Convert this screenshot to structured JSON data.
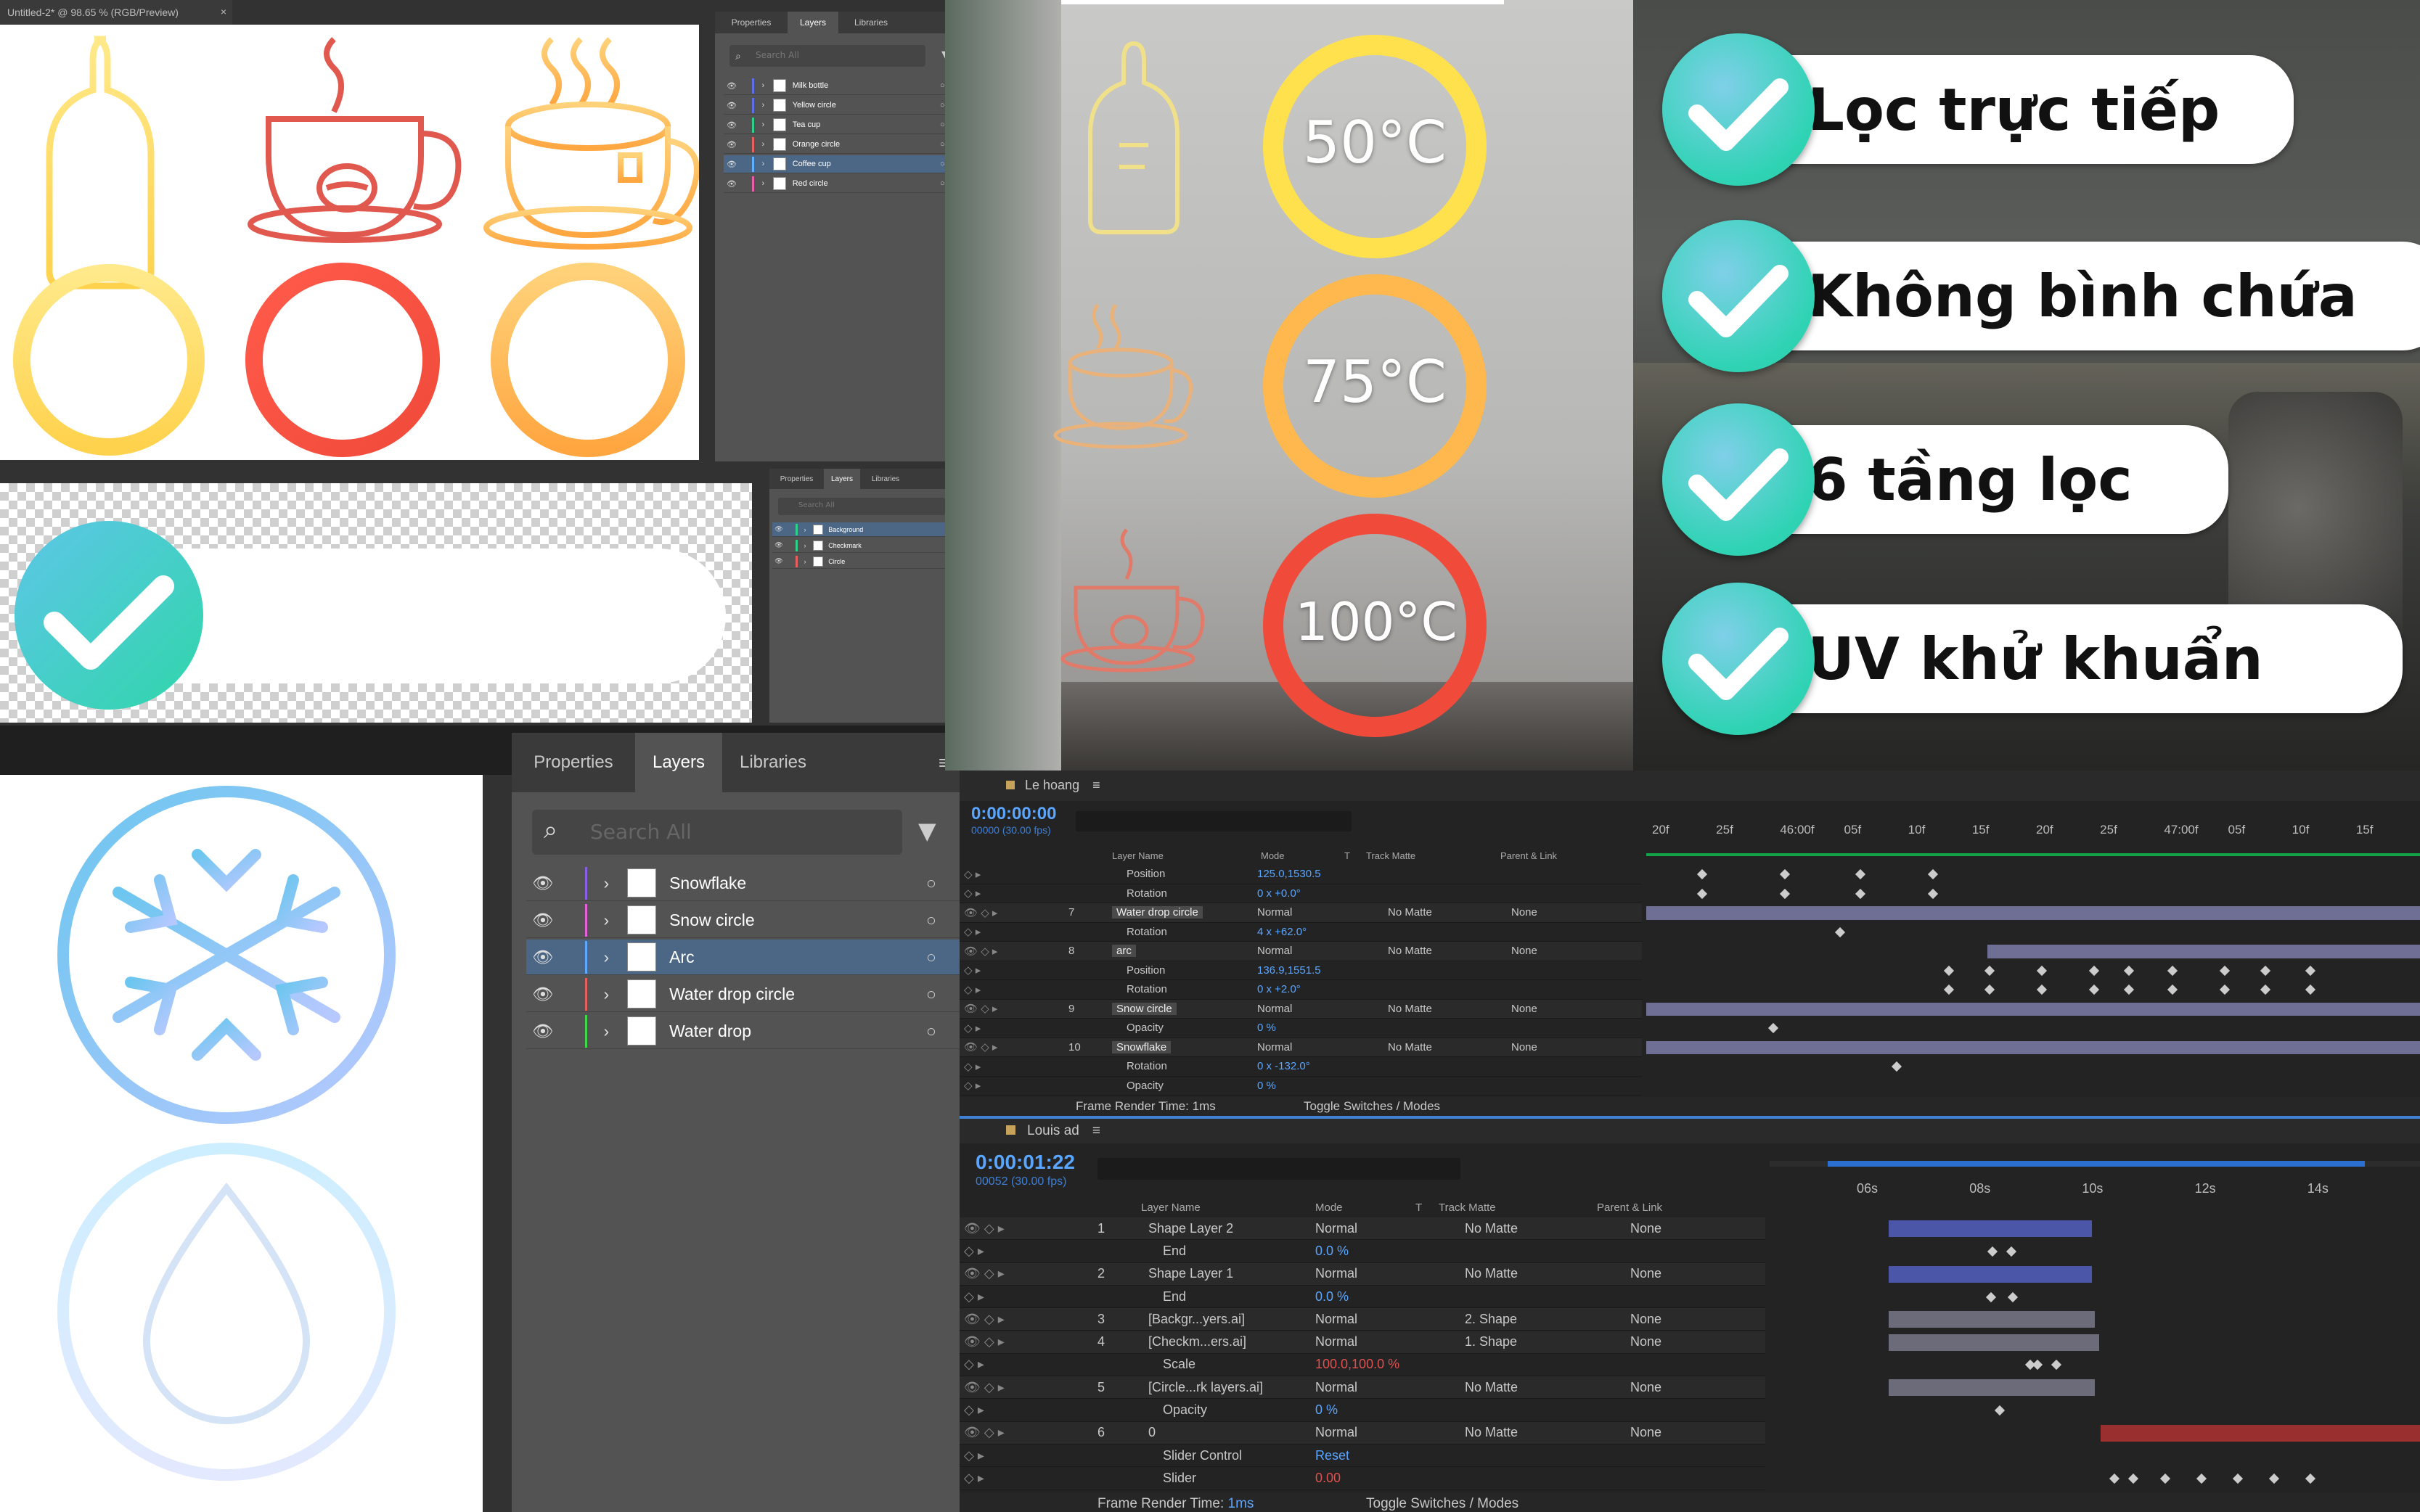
{
  "ai_doc_tab": "Untitled-2* @ 98.65 % (RGB/Preview)",
  "panel_tabs": {
    "properties": "Properties",
    "layers": "Layers",
    "libraries": "Libraries"
  },
  "search_placeholder": "Search All",
  "layers_panel1": [
    "Milk bottle",
    "Yellow circle",
    "Tea cup",
    "Orange circle",
    "Coffee cup",
    "Red circle"
  ],
  "layers_panel2": [
    "Background",
    "Checkmark",
    "Circle"
  ],
  "layers_panel3": [
    "Snowflake",
    "Snow circle",
    "Arc",
    "Water drop circle",
    "Water drop"
  ],
  "video": {
    "temps": [
      "50°C",
      "75°C",
      "100°C"
    ],
    "features": [
      "Lọc trực tiếp",
      "Không bình chứa",
      "6 tầng lọc",
      "UV khử khuẩn"
    ]
  },
  "ae1": {
    "comp": "Le hoang",
    "timecode": "0:00:00:00",
    "fps": "00000 (30.00 fps)",
    "col_layer": "Layer Name",
    "col_mode": "Mode",
    "col_t": "T",
    "col_track": "Track Matte",
    "col_parent": "Parent & Link",
    "ruler": [
      "20f",
      "25f",
      "46:00f",
      "05f",
      "10f",
      "15f",
      "20f",
      "25f",
      "47:00f",
      "05f",
      "10f",
      "15f"
    ],
    "rows": [
      {
        "num": "",
        "name": "Position",
        "value": "125.0,1530.5",
        "type": "prop"
      },
      {
        "num": "",
        "name": "Rotation",
        "value": "0 x +0.0°",
        "type": "prop"
      },
      {
        "num": "7",
        "name": "Water drop circle",
        "mode": "Normal",
        "matte": "No Matte",
        "parent": "None",
        "type": "layer"
      },
      {
        "num": "",
        "name": "Rotation",
        "value": "4 x +62.0°",
        "type": "prop"
      },
      {
        "num": "8",
        "name": "arc",
        "mode": "Normal",
        "matte": "No Matte",
        "parent": "None",
        "type": "layer"
      },
      {
        "num": "",
        "name": "Position",
        "value": "136.9,1551.5",
        "type": "prop"
      },
      {
        "num": "",
        "name": "Rotation",
        "value": "0 x +2.0°",
        "type": "prop"
      },
      {
        "num": "9",
        "name": "Snow circle",
        "mode": "Normal",
        "matte": "No Matte",
        "parent": "None",
        "type": "layer"
      },
      {
        "num": "",
        "name": "Opacity",
        "value": "0 %",
        "type": "prop"
      },
      {
        "num": "10",
        "name": "Snowflake",
        "mode": "Normal",
        "matte": "No Matte",
        "parent": "None",
        "type": "layer"
      },
      {
        "num": "",
        "name": "Rotation",
        "value": "0 x -132.0°",
        "type": "prop"
      },
      {
        "num": "",
        "name": "Opacity",
        "value": "0 %",
        "type": "prop"
      }
    ],
    "footer_render": "Frame Render Time:",
    "footer_time": "1ms",
    "footer_toggle": "Toggle Switches / Modes"
  },
  "ae2": {
    "comp": "Louis ad",
    "timecode": "0:00:01:22",
    "fps": "00052 (30.00 fps)",
    "col_layer": "Layer Name",
    "col_mode": "Mode",
    "col_t": "T",
    "col_track": "Track Matte",
    "col_parent": "Parent & Link",
    "ruler": [
      "06s",
      "08s",
      "10s",
      "12s",
      "14s"
    ],
    "rows": [
      {
        "num": "1",
        "name": "Shape Layer 2",
        "mode": "Normal",
        "matte": "No Matte",
        "parent": "None",
        "type": "layer"
      },
      {
        "num": "",
        "name": "End",
        "value": "0.0 %",
        "type": "prop"
      },
      {
        "num": "2",
        "name": "Shape Layer 1",
        "mode": "Normal",
        "matte": "No Matte",
        "parent": "None",
        "type": "layer"
      },
      {
        "num": "",
        "name": "End",
        "value": "0.0 %",
        "type": "prop"
      },
      {
        "num": "3",
        "name": "[Backgr...yers.ai]",
        "mode": "Normal",
        "matte": "2. Shape",
        "parent": "None",
        "type": "layer"
      },
      {
        "num": "4",
        "name": "[Checkm...ers.ai]",
        "mode": "Normal",
        "matte": "1. Shape",
        "parent": "None",
        "type": "layer"
      },
      {
        "num": "",
        "name": "Scale",
        "value": "100.0,100.0 %",
        "type": "prop"
      },
      {
        "num": "5",
        "name": "[Circle...rk layers.ai]",
        "mode": "Normal",
        "matte": "No Matte",
        "parent": "None",
        "type": "layer"
      },
      {
        "num": "",
        "name": "Opacity",
        "value": "0 %",
        "type": "prop"
      },
      {
        "num": "6",
        "name": "0",
        "mode": "Normal",
        "matte": "No Matte",
        "parent": "None",
        "type": "layer"
      },
      {
        "num": "",
        "name": "Slider Control",
        "value": "Reset",
        "type": "prop"
      },
      {
        "num": "",
        "name": "Slider",
        "value": "0.00",
        "type": "prop"
      }
    ],
    "footer_render": "Frame Render Time:",
    "footer_time": "1ms",
    "footer_toggle": "Toggle Switches / Modes"
  }
}
